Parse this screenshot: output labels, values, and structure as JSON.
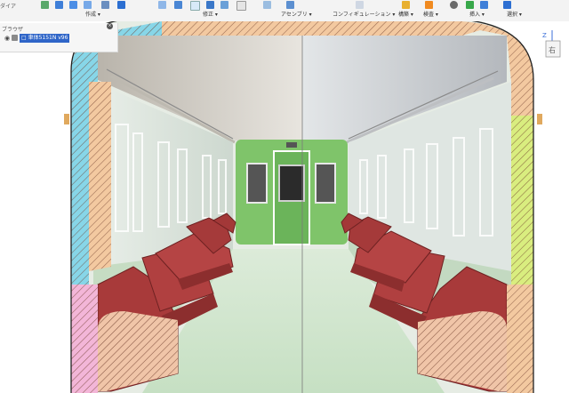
{
  "toolbar": {
    "left_cut_label": "ダイア",
    "groups": [
      {
        "label": "作成 ▾"
      },
      {
        "label": "修正 ▾"
      },
      {
        "label": "アセンブリ ▾"
      },
      {
        "label": "コンフィギュレーション ▾"
      },
      {
        "label": "構築 ▾"
      },
      {
        "label": "検査 ▾"
      },
      {
        "label": "挿入 ▾"
      },
      {
        "label": "選択 ▾"
      }
    ]
  },
  "browser": {
    "title": "ブラウザ",
    "component_label": "□ 車体5151N v96"
  },
  "viewcube": {
    "axis_label": "Z",
    "face_label": "右"
  },
  "colors": {
    "wall_green": "#c9dcc6",
    "seat_red": "#a83a3a",
    "end_wall_green": "#7fc46a",
    "section_cyan": "#87d6e8",
    "section_orange": "#f3c9a0",
    "section_pink": "#f3b6d8",
    "section_lime": "#d9ed7f",
    "floor_green": "#cfe6cd"
  }
}
